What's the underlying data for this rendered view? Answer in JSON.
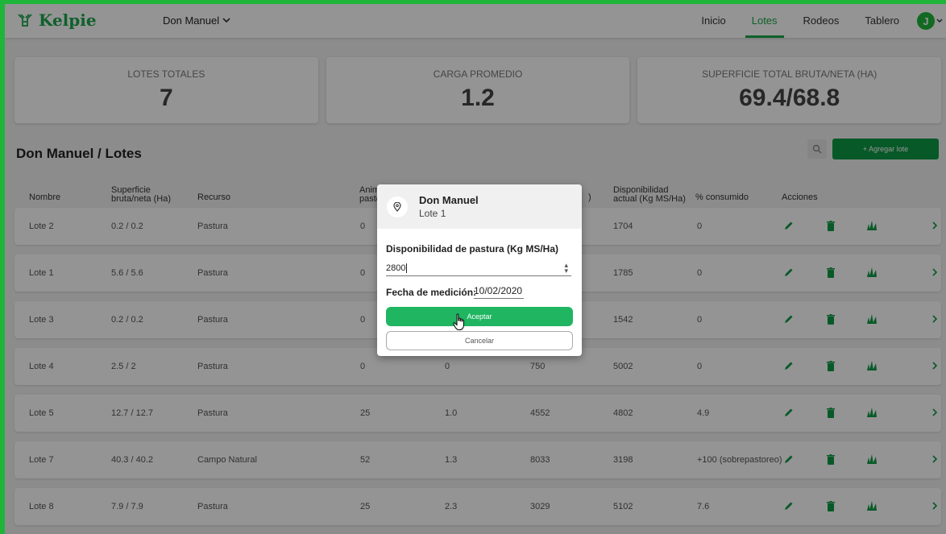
{
  "app": {
    "name": "Kelpie",
    "farm": "Don Manuel"
  },
  "nav": {
    "items": [
      "Inicio",
      "Lotes",
      "Rodeos",
      "Tablero"
    ],
    "active": "Lotes",
    "avatar_initial": "J"
  },
  "stats": [
    {
      "label": "LOTES TOTALES",
      "value": "7"
    },
    {
      "label": "CARGA PROMEDIO",
      "value": "1.2"
    },
    {
      "label": "SUPERFICIE TOTAL BRUTA/NETA (HA)",
      "value": "69.4/68.8"
    }
  ],
  "page": {
    "title": "Don Manuel / Lotes",
    "add_button": "+ Agregar lote"
  },
  "table": {
    "headers": {
      "nombre": "Nombre",
      "superficie_1": "Superficie",
      "superficie_2": "bruta/neta (Ha)",
      "recurso": "Recurso",
      "animales_1": "Anim",
      "animales_2": "pasto",
      "col_hidden": ")",
      "disponibilidad_1": "Disponibilidad",
      "disponibilidad_2": "actual (Kg MS/Ha)",
      "consumido": "% consumido",
      "acciones": "Acciones"
    },
    "rows": [
      {
        "nombre": "Lote 2",
        "superficie": "0.2 / 0.2",
        "recurso": "Pastura",
        "animales": "0",
        "carga": "",
        "requerimiento": "",
        "disponibilidad": "1704",
        "consumido": "0"
      },
      {
        "nombre": "Lote 1",
        "superficie": "5.6 / 5.6",
        "recurso": "Pastura",
        "animales": "0",
        "carga": "",
        "requerimiento": "",
        "disponibilidad": "1785",
        "consumido": "0"
      },
      {
        "nombre": "Lote 3",
        "superficie": "0.2 / 0.2",
        "recurso": "Pastura",
        "animales": "0",
        "carga": "",
        "requerimiento": "",
        "disponibilidad": "1542",
        "consumido": "0"
      },
      {
        "nombre": "Lote 4",
        "superficie": "2.5 / 2",
        "recurso": "Pastura",
        "animales": "0",
        "carga": "0",
        "requerimiento": "750",
        "disponibilidad": "5002",
        "consumido": "0"
      },
      {
        "nombre": "Lote 5",
        "superficie": "12.7 / 12.7",
        "recurso": "Pastura",
        "animales": "25",
        "carga": "1.0",
        "requerimiento": "4552",
        "disponibilidad": "4802",
        "consumido": "4.9"
      },
      {
        "nombre": "Lote 7",
        "superficie": "40.3 / 40.2",
        "recurso": "Campo Natural",
        "animales": "52",
        "carga": "1.3",
        "requerimiento": "8033",
        "disponibilidad": "3198",
        "consumido": "+100 (sobrepastoreo)"
      },
      {
        "nombre": "Lote 8",
        "superficie": "7.9 / 7.9",
        "recurso": "Pastura",
        "animales": "25",
        "carga": "2.3",
        "requerimiento": "3029",
        "disponibilidad": "5102",
        "consumido": "7.6"
      }
    ]
  },
  "modal": {
    "title": "Don Manuel",
    "subtitle": "Lote 1",
    "field_label": "Disponibilidad de pastura (Kg MS/Ha)",
    "field_value": "2800",
    "date_label": "Fecha de medición:",
    "date_value": "10/02/2020",
    "accept": "Aceptar",
    "cancel": "Cancelar"
  },
  "colors": {
    "brand": "#1aa64a",
    "accept": "#1fb561",
    "icon_green": "#0f9a45"
  }
}
